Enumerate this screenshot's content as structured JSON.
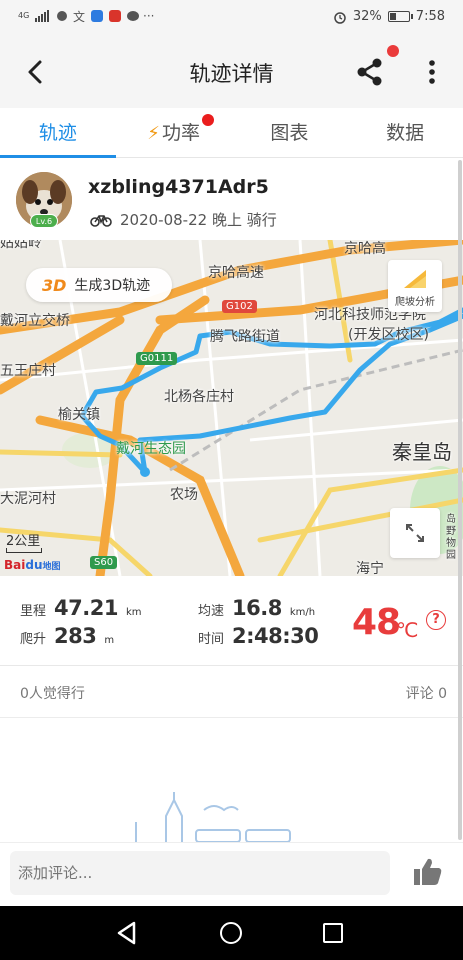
{
  "status_bar": {
    "network": "4G",
    "battery": "32%",
    "time": "7:58",
    "icons": [
      "signal-icon",
      "notification-icons",
      "alarm-icon",
      "battery-icon"
    ]
  },
  "header": {
    "title": "轨迹详情",
    "back_icon": "chevron-left-icon",
    "share_icon": "share-icon",
    "more_icon": "more-vertical-icon"
  },
  "tabs": [
    {
      "label": "轨迹",
      "active": true
    },
    {
      "label": "功率",
      "active": false
    },
    {
      "label": "图表",
      "active": false
    },
    {
      "label": "数据",
      "active": false
    }
  ],
  "profile": {
    "username": "xzbling4371Adr5",
    "level": "Lv.6",
    "date": "2020-08-22 晚上 骑行",
    "activity_icon": "bicycle-icon"
  },
  "map": {
    "btn_3d_prefix": "3D",
    "btn_3d_label": "生成3D轨迹",
    "climb_label": "爬坡分析",
    "scale_label": "2公里",
    "baidu_logo_left": "Bai",
    "baidu_logo_right": "du",
    "baidu_logo_suffix": "地图",
    "labels": [
      {
        "text": "京哈高速"
      },
      {
        "text": "京哈高"
      },
      {
        "text": "戴河立交桥"
      },
      {
        "text": "河北科技师范学院"
      },
      {
        "text": "(开发区校区)"
      },
      {
        "text": "五王庄村"
      },
      {
        "text": "腾飞路街道"
      },
      {
        "text": "北杨各庄村"
      },
      {
        "text": "榆关镇"
      },
      {
        "text": "戴河生态园"
      },
      {
        "text": "秦皇岛"
      },
      {
        "text": "大泥河村"
      },
      {
        "text": "农场"
      },
      {
        "text": "海宁"
      },
      {
        "text": "姑姑岭"
      },
      {
        "text": "岛野物园"
      }
    ],
    "road_badges": [
      {
        "text": "G102"
      },
      {
        "text": "G0111"
      },
      {
        "text": "S60"
      }
    ],
    "track_color": "#38a8ec"
  },
  "stats": {
    "distance_label": "里程",
    "distance_value": "47.21",
    "distance_unit": "km",
    "speed_label": "均速",
    "speed_value": "16.8",
    "speed_unit": "km/h",
    "climb_label": "爬升",
    "climb_value": "283",
    "climb_unit": "m",
    "time_label": "时间",
    "time_value": "2:48:30",
    "temperature_value": "48",
    "temperature_unit": "℃",
    "help_symbol": "?"
  },
  "social": {
    "likes_text": "0人觉得行",
    "comments_text": "评论 0"
  },
  "comment_bar": {
    "placeholder": "添加评论...",
    "like_icon": "thumbs-up-icon"
  },
  "colors": {
    "accent": "#1f8ee6",
    "temperature": "#e83c3c",
    "notification_dot": "#ea3b3b",
    "bolt": "#f19a14"
  }
}
